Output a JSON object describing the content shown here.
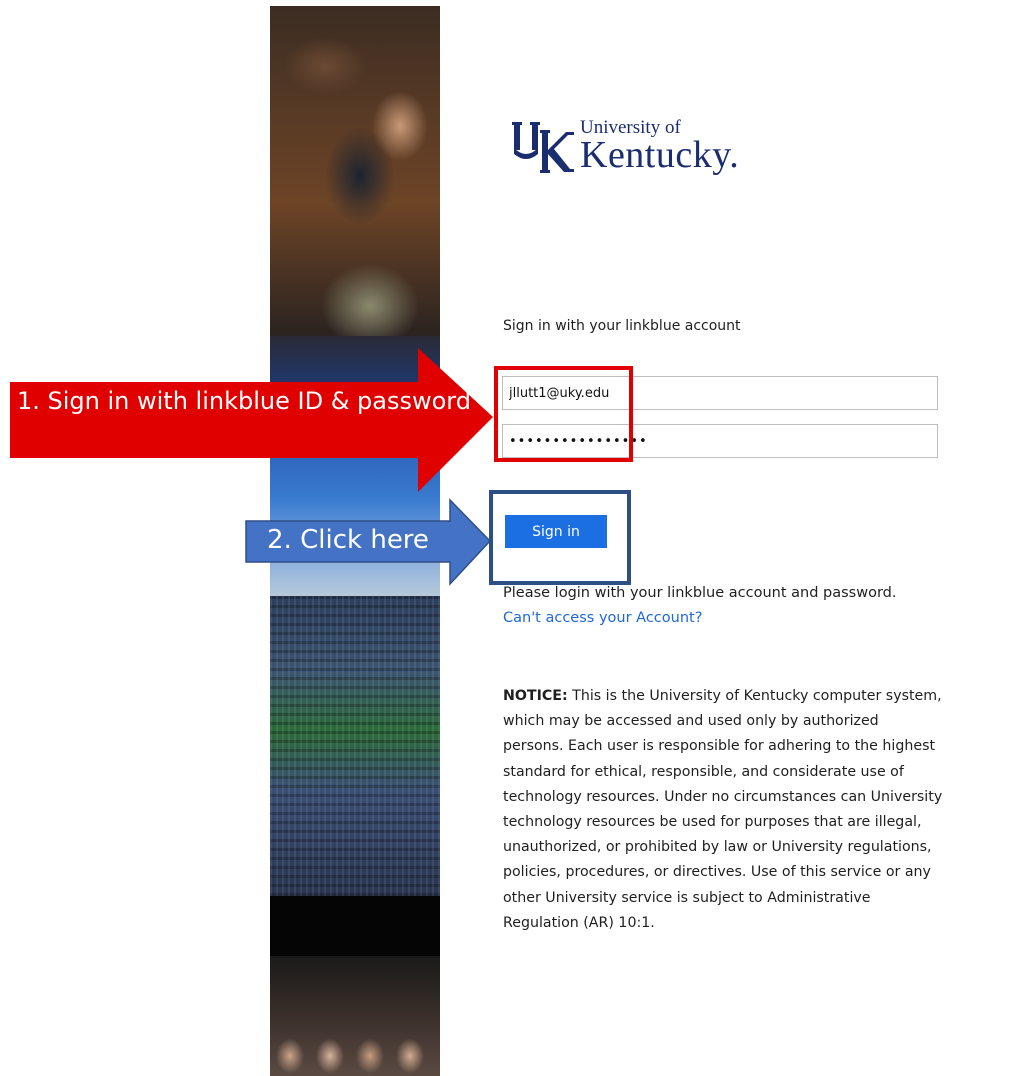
{
  "logo": {
    "line1": "University of",
    "line2": "Kentucky."
  },
  "form": {
    "prompt": "Sign in with your linkblue account",
    "username_value": "jllutt1@uky.edu",
    "password_value": "••••••••••••••••",
    "signin_label": "Sign in"
  },
  "help": {
    "login_message": "Please login with your linkblue account and password.",
    "access_link": "Can't access your Account?"
  },
  "notice": {
    "label": "NOTICE:",
    "text": " This is the University of Kentucky computer system, which may be accessed and used only by authorized persons. Each user is responsible for adhering to the highest standard for ethical, responsible, and considerate use of technology resources. Under no circumstances can University technology resources be used for purposes that are illegal, unauthorized, or prohibited by law or University regulations, policies, procedures, or directives. Use of this service or any other University service is subject to Administrative Regulation (AR) 10:1."
  },
  "annotations": {
    "step1": "1. Sign in with linkblue ID & password",
    "step2": "2. Click here",
    "step1_color": "#e10000",
    "step2_color": "#4472c4"
  },
  "colors": {
    "brand_blue": "#1a2d6e",
    "button_blue": "#1b6fe3",
    "link_blue": "#1e68d8"
  }
}
